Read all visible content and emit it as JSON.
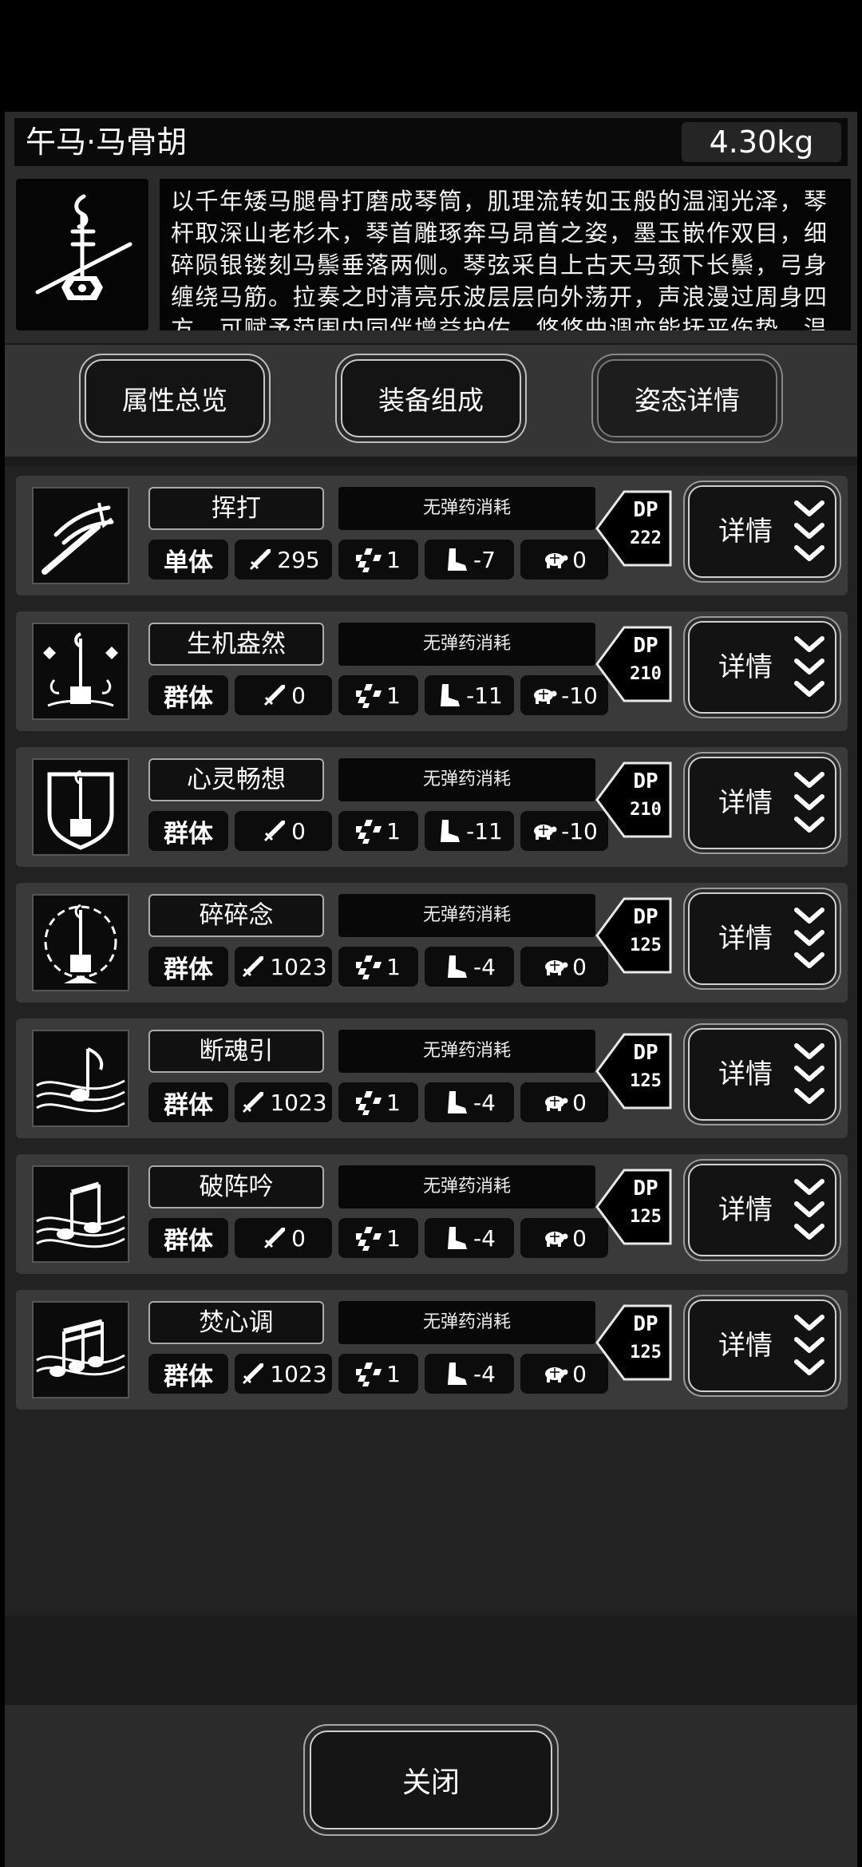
{
  "item": {
    "name": "午马·马骨胡",
    "weight": "4.30kg",
    "description": "以千年矮马腿骨打磨成琴筒，肌理流转如玉般的温润光泽，琴杆取深山老杉木，琴首雕琢奔马昂首之姿，墨玉嵌作双目，细碎陨银镂刻马鬃垂落两侧。琴弦采自上古天马颈下长鬃，弓身缠绕马筋。拉奏之时清亮乐波层层向外荡开，声浪漫过周身四方，可赋予范围内同伴增益护佑，悠悠曲调亦能抚平伤势，温养气血，抵"
  },
  "tabs": [
    "属性总览",
    "装备组成",
    "姿态详情"
  ],
  "skills": [
    {
      "name": "挥打",
      "ammo": "无弹药消耗",
      "type": "单体",
      "atk": "295",
      "hit": "1",
      "move": "-7",
      "def": "0",
      "dp_label": "DP",
      "dp": "222",
      "detail": "详情",
      "icon": "swing-icon"
    },
    {
      "name": "生机盎然",
      "ammo": "无弹药消耗",
      "type": "群体",
      "atk": "0",
      "hit": "1",
      "move": "-11",
      "def": "-10",
      "dp_label": "DP",
      "dp": "210",
      "detail": "详情",
      "icon": "lotus-instrument-icon"
    },
    {
      "name": "心灵畅想",
      "ammo": "无弹药消耗",
      "type": "群体",
      "atk": "0",
      "hit": "1",
      "move": "-11",
      "def": "-10",
      "dp_label": "DP",
      "dp": "210",
      "detail": "详情",
      "icon": "shield-instrument-icon"
    },
    {
      "name": "碎碎念",
      "ammo": "无弹药消耗",
      "type": "群体",
      "atk": "1023",
      "hit": "1",
      "move": "-4",
      "def": "0",
      "dp_label": "DP",
      "dp": "125",
      "detail": "详情",
      "icon": "burst-instrument-icon"
    },
    {
      "name": "断魂引",
      "ammo": "无弹药消耗",
      "type": "群体",
      "atk": "1023",
      "hit": "1",
      "move": "-4",
      "def": "0",
      "dp_label": "DP",
      "dp": "125",
      "detail": "详情",
      "icon": "single-note-icon"
    },
    {
      "name": "破阵吟",
      "ammo": "无弹药消耗",
      "type": "群体",
      "atk": "0",
      "hit": "1",
      "move": "-4",
      "def": "0",
      "dp_label": "DP",
      "dp": "125",
      "detail": "详情",
      "icon": "double-note-icon"
    },
    {
      "name": "焚心调",
      "ammo": "无弹药消耗",
      "type": "群体",
      "atk": "1023",
      "hit": "1",
      "move": "-4",
      "def": "0",
      "dp_label": "DP",
      "dp": "125",
      "detail": "详情",
      "icon": "triple-note-icon"
    }
  ],
  "footer": {
    "close": "关闭"
  }
}
